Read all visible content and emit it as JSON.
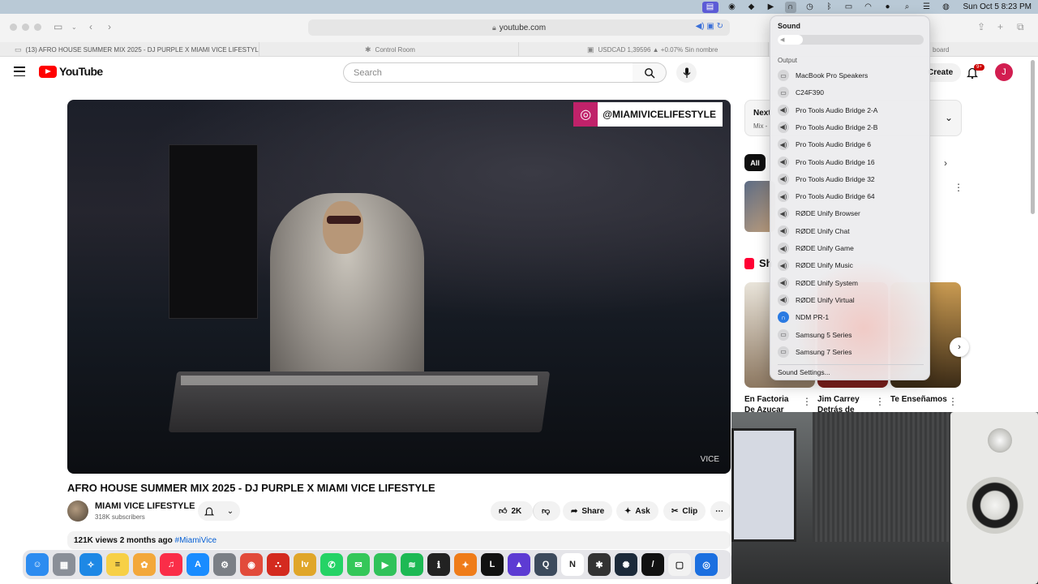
{
  "menubar": {
    "datetime": "Sun Oct 5  8:23 PM"
  },
  "browser": {
    "url": "youtube.com",
    "tabs": [
      {
        "label": "(13) AFRO HOUSE SUMMER MIX 2025 - DJ PURPLE X MIAMI VICE LIFESTYLE..."
      },
      {
        "label": "Control Room"
      },
      {
        "label": "USDCAD 1,39596 ▲ +0.07% Sin nombre"
      },
      {
        "label": "board"
      }
    ]
  },
  "youtube": {
    "logo_text": "YouTube",
    "search_placeholder": "Search",
    "create_label": "Create",
    "notif_count": "9+",
    "avatar_letter": "J",
    "video": {
      "overlay_handle": "@MIAMIVICELIFESTYLE",
      "watermark": "VICE",
      "title": "AFRO HOUSE SUMMER MIX 2025 - DJ PURPLE X MIAMI VICE LIFESTYLE",
      "channel": "MIAMI VICE LIFESTYLE",
      "subscribers": "318K subscribers",
      "likes": "2K",
      "share": "Share",
      "ask": "Ask",
      "clip": "Clip",
      "views": "121K views",
      "age": "2 months ago",
      "hashtag": "#MiamiVice"
    },
    "sidebar": {
      "next_title": "Next",
      "next_sub": "Mix -",
      "chip_all": "All",
      "shorts_label": "Sh",
      "shorts": [
        {
          "title": "En Factoria De Azucar"
        },
        {
          "title": "Jim Carrey Detrás de"
        },
        {
          "title": "Te Enseñamos"
        }
      ]
    }
  },
  "sound_menu": {
    "title": "Sound",
    "volume": 0.17,
    "output_label": "Output",
    "devices": [
      {
        "name": "MacBook Pro Speakers",
        "icon": "laptop-icon",
        "selected": false
      },
      {
        "name": "C24F390",
        "icon": "display-icon",
        "selected": false
      },
      {
        "name": "Pro Tools Audio Bridge 2-A",
        "icon": "speaker-icon",
        "selected": false
      },
      {
        "name": "Pro Tools Audio Bridge 2-B",
        "icon": "speaker-icon",
        "selected": false
      },
      {
        "name": "Pro Tools Audio Bridge 6",
        "icon": "speaker-icon",
        "selected": false
      },
      {
        "name": "Pro Tools Audio Bridge 16",
        "icon": "speaker-icon",
        "selected": false
      },
      {
        "name": "Pro Tools Audio Bridge 32",
        "icon": "speaker-icon",
        "selected": false
      },
      {
        "name": "Pro Tools Audio Bridge 64",
        "icon": "speaker-icon",
        "selected": false
      },
      {
        "name": "RØDE Unify Browser",
        "icon": "speaker-icon",
        "selected": false
      },
      {
        "name": "RØDE Unify Chat",
        "icon": "speaker-icon",
        "selected": false
      },
      {
        "name": "RØDE Unify Game",
        "icon": "speaker-icon",
        "selected": false
      },
      {
        "name": "RØDE Unify Music",
        "icon": "speaker-icon",
        "selected": false
      },
      {
        "name": "RØDE Unify System",
        "icon": "speaker-icon",
        "selected": false
      },
      {
        "name": "RØDE Unify Virtual",
        "icon": "speaker-icon",
        "selected": false
      },
      {
        "name": "NDM PR-1",
        "icon": "headphones-icon",
        "selected": true
      },
      {
        "name": "Samsung 5 Series",
        "icon": "display-icon",
        "selected": false
      },
      {
        "name": "Samsung 7 Series",
        "icon": "display-icon",
        "selected": false
      }
    ],
    "settings_label": "Sound Settings..."
  },
  "dock": {
    "apps": [
      {
        "name": "finder",
        "color": "#2d8cf0",
        "glyph": "☺"
      },
      {
        "name": "launchpad",
        "color": "#8a8f98",
        "glyph": "▦"
      },
      {
        "name": "safari",
        "color": "#1e88e5",
        "glyph": "✧"
      },
      {
        "name": "notes",
        "color": "#f7d046",
        "glyph": "≡"
      },
      {
        "name": "photos",
        "color": "#f3a83b",
        "glyph": "✿"
      },
      {
        "name": "music",
        "color": "#fa2d48",
        "glyph": "♫"
      },
      {
        "name": "app-store",
        "color": "#1a8cff",
        "glyph": "A"
      },
      {
        "name": "system-settings",
        "color": "#7b7f86",
        "glyph": "⚙"
      },
      {
        "name": "chrome",
        "color": "#e24b3b",
        "glyph": "◉"
      },
      {
        "name": "acrobat",
        "color": "#d42a1f",
        "glyph": "⛬"
      },
      {
        "name": "iv",
        "color": "#e0a62a",
        "glyph": "Iv"
      },
      {
        "name": "whatsapp",
        "color": "#25d366",
        "glyph": "✆"
      },
      {
        "name": "messages",
        "color": "#34c759",
        "glyph": "✉"
      },
      {
        "name": "facetime",
        "color": "#30c25a",
        "glyph": "▶"
      },
      {
        "name": "spotify",
        "color": "#1db954",
        "glyph": "≋"
      },
      {
        "name": "ilok",
        "color": "#222222",
        "glyph": "ℹ"
      },
      {
        "name": "fl-studio",
        "color": "#ef7c1a",
        "glyph": "✦"
      },
      {
        "name": "live",
        "color": "#111111",
        "glyph": "L"
      },
      {
        "name": "avid",
        "color": "#5d3bd3",
        "glyph": "▲"
      },
      {
        "name": "quicktime",
        "color": "#3c4a5c",
        "glyph": "Q"
      },
      {
        "name": "notion",
        "color": "#ffffff",
        "glyph": "N"
      },
      {
        "name": "plugin-app",
        "color": "#333333",
        "glyph": "✱"
      },
      {
        "name": "network-app",
        "color": "#1c2a3a",
        "glyph": "✺"
      },
      {
        "name": "slash-app",
        "color": "#111111",
        "glyph": "/"
      },
      {
        "name": "calendar",
        "color": "#f2f2f2",
        "glyph": "▢"
      },
      {
        "name": "blue-app",
        "color": "#1b6fe0",
        "glyph": "◎"
      }
    ]
  }
}
